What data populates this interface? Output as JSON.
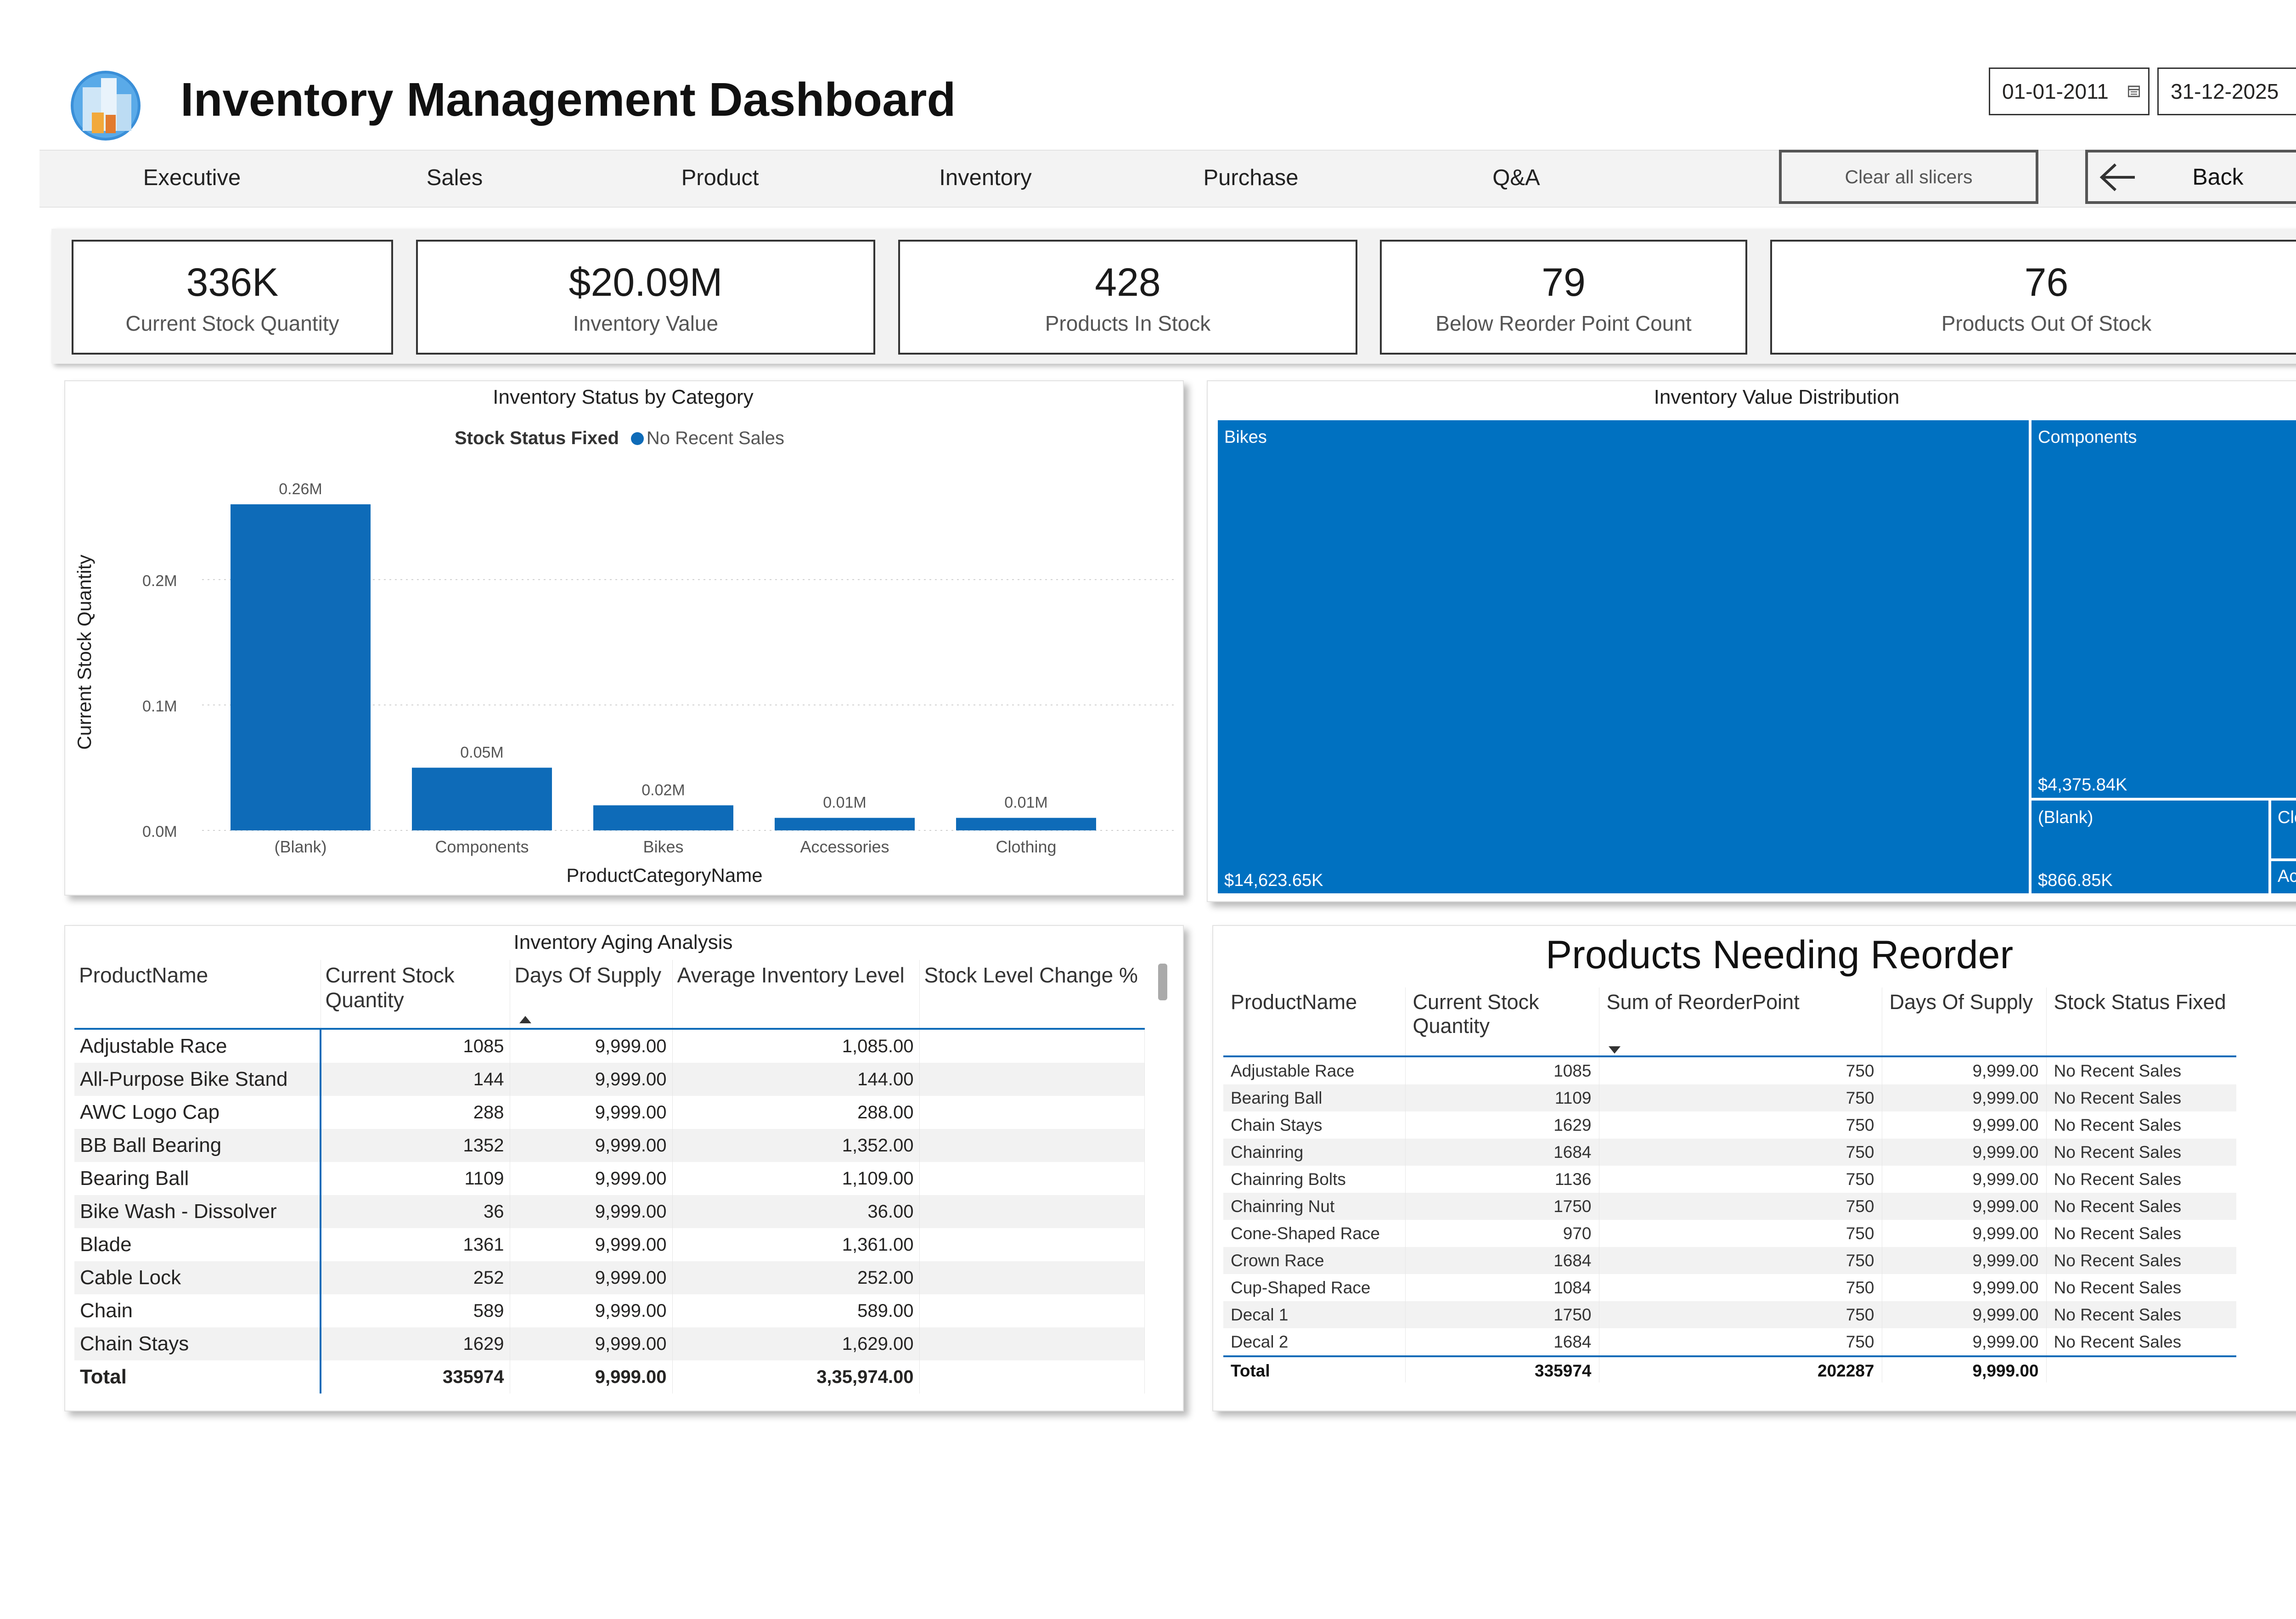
{
  "header": {
    "title": "Inventory Management Dashboard",
    "date_start": "01-01-2011",
    "date_end": "31-12-2025"
  },
  "nav": {
    "items": [
      "Executive",
      "Sales",
      "Product",
      "Inventory",
      "Purchase",
      "Q&A"
    ],
    "clear_label": "Clear all slicers",
    "back_label": "Back"
  },
  "kpis": [
    {
      "value": "336K",
      "label": "Current Stock Quantity"
    },
    {
      "value": "$20.09M",
      "label": "Inventory Value"
    },
    {
      "value": "428",
      "label": "Products In Stock"
    },
    {
      "value": "79",
      "label": "Below Reorder Point Count"
    },
    {
      "value": "76",
      "label": "Products Out Of Stock"
    }
  ],
  "chart_data": [
    {
      "type": "bar",
      "title": "Inventory Status by Category",
      "legend_title": "Stock Status Fixed",
      "legend_placement": "top",
      "categories": [
        "(Blank)",
        "Components",
        "Bikes",
        "Accessories",
        "Clothing"
      ],
      "series": [
        {
          "name": "No Recent Sales",
          "values": [
            0.26,
            0.05,
            0.02,
            0.01,
            0.01
          ],
          "color": "#0e6bb8"
        }
      ],
      "data_labels": [
        "0.26M",
        "0.05M",
        "0.02M",
        "0.01M",
        "0.01M"
      ],
      "xlabel": "ProductCategoryName",
      "ylabel": "Current Stock Quantity",
      "ylim": [
        0,
        0.26
      ],
      "yticks": [
        {
          "value": 0,
          "label": "0.0M"
        },
        {
          "value": 0.1,
          "label": "0.1M"
        },
        {
          "value": 0.2,
          "label": "0.2M"
        }
      ],
      "grid": true
    },
    {
      "type": "treemap",
      "title": "Inventory Value Distribution",
      "color": "#0071c1",
      "items": [
        {
          "name": "Bikes",
          "label": "$14,623.65K"
        },
        {
          "name": "Components",
          "label": "$4,375.84K"
        },
        {
          "name": "(Blank)",
          "label": "$866.85K"
        },
        {
          "name": "Clot...",
          "label": ""
        },
        {
          "name": "Acc...",
          "label": ""
        }
      ]
    }
  ],
  "aging": {
    "title": "Inventory Aging Analysis",
    "headers": [
      "ProductName",
      "Current Stock Quantity",
      "Days Of Supply",
      "Average Inventory Level",
      "Stock Level Change %"
    ],
    "rows": [
      [
        "Adjustable Race",
        "1085",
        "9,999.00",
        "1,085.00",
        ""
      ],
      [
        "All-Purpose Bike Stand",
        "144",
        "9,999.00",
        "144.00",
        ""
      ],
      [
        "AWC Logo Cap",
        "288",
        "9,999.00",
        "288.00",
        ""
      ],
      [
        "BB Ball Bearing",
        "1352",
        "9,999.00",
        "1,352.00",
        ""
      ],
      [
        "Bearing Ball",
        "1109",
        "9,999.00",
        "1,109.00",
        ""
      ],
      [
        "Bike Wash - Dissolver",
        "36",
        "9,999.00",
        "36.00",
        ""
      ],
      [
        "Blade",
        "1361",
        "9,999.00",
        "1,361.00",
        ""
      ],
      [
        "Cable Lock",
        "252",
        "9,999.00",
        "252.00",
        ""
      ],
      [
        "Chain",
        "589",
        "9,999.00",
        "589.00",
        ""
      ],
      [
        "Chain Stays",
        "1629",
        "9,999.00",
        "1,629.00",
        ""
      ]
    ],
    "total": [
      "Total",
      "335974",
      "9,999.00",
      "3,35,974.00",
      ""
    ]
  },
  "reorder": {
    "title": "Products Needing Reorder",
    "headers": [
      "ProductName",
      "Current Stock Quantity",
      "Sum of ReorderPoint",
      "Days Of Supply",
      "Stock Status Fixed"
    ],
    "rows": [
      [
        "Adjustable Race",
        "1085",
        "750",
        "9,999.00",
        "No Recent Sales"
      ],
      [
        "Bearing Ball",
        "1109",
        "750",
        "9,999.00",
        "No Recent Sales"
      ],
      [
        "Chain Stays",
        "1629",
        "750",
        "9,999.00",
        "No Recent Sales"
      ],
      [
        "Chainring",
        "1684",
        "750",
        "9,999.00",
        "No Recent Sales"
      ],
      [
        "Chainring Bolts",
        "1136",
        "750",
        "9,999.00",
        "No Recent Sales"
      ],
      [
        "Chainring Nut",
        "1750",
        "750",
        "9,999.00",
        "No Recent Sales"
      ],
      [
        "Cone-Shaped Race",
        "970",
        "750",
        "9,999.00",
        "No Recent Sales"
      ],
      [
        "Crown Race",
        "1684",
        "750",
        "9,999.00",
        "No Recent Sales"
      ],
      [
        "Cup-Shaped Race",
        "1084",
        "750",
        "9,999.00",
        "No Recent Sales"
      ],
      [
        "Decal 1",
        "1750",
        "750",
        "9,999.00",
        "No Recent Sales"
      ],
      [
        "Decal 2",
        "1684",
        "750",
        "9,999.00",
        "No Recent Sales"
      ]
    ],
    "total": [
      "Total",
      "335974",
      "202287",
      "9,999.00",
      ""
    ]
  }
}
